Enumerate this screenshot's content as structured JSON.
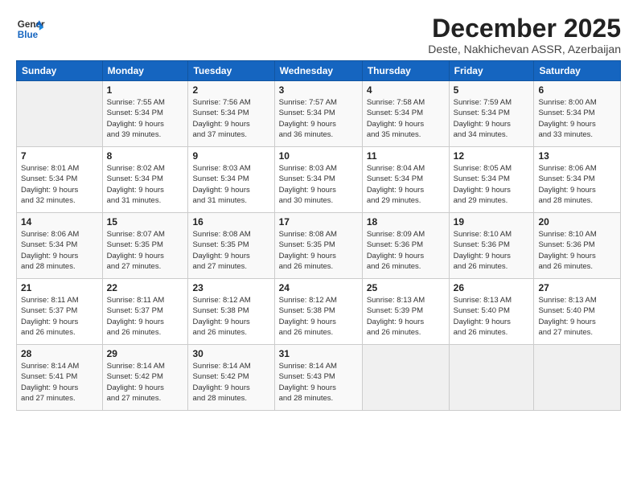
{
  "logo": {
    "line1": "General",
    "line2": "Blue"
  },
  "title": "December 2025",
  "location": "Deste, Nakhichevan ASSR, Azerbaijan",
  "days_of_week": [
    "Sunday",
    "Monday",
    "Tuesday",
    "Wednesday",
    "Thursday",
    "Friday",
    "Saturday"
  ],
  "weeks": [
    [
      {
        "day": "",
        "info": ""
      },
      {
        "day": "1",
        "info": "Sunrise: 7:55 AM\nSunset: 5:34 PM\nDaylight: 9 hours\nand 39 minutes."
      },
      {
        "day": "2",
        "info": "Sunrise: 7:56 AM\nSunset: 5:34 PM\nDaylight: 9 hours\nand 37 minutes."
      },
      {
        "day": "3",
        "info": "Sunrise: 7:57 AM\nSunset: 5:34 PM\nDaylight: 9 hours\nand 36 minutes."
      },
      {
        "day": "4",
        "info": "Sunrise: 7:58 AM\nSunset: 5:34 PM\nDaylight: 9 hours\nand 35 minutes."
      },
      {
        "day": "5",
        "info": "Sunrise: 7:59 AM\nSunset: 5:34 PM\nDaylight: 9 hours\nand 34 minutes."
      },
      {
        "day": "6",
        "info": "Sunrise: 8:00 AM\nSunset: 5:34 PM\nDaylight: 9 hours\nand 33 minutes."
      }
    ],
    [
      {
        "day": "7",
        "info": "Sunrise: 8:01 AM\nSunset: 5:34 PM\nDaylight: 9 hours\nand 32 minutes."
      },
      {
        "day": "8",
        "info": "Sunrise: 8:02 AM\nSunset: 5:34 PM\nDaylight: 9 hours\nand 31 minutes."
      },
      {
        "day": "9",
        "info": "Sunrise: 8:03 AM\nSunset: 5:34 PM\nDaylight: 9 hours\nand 31 minutes."
      },
      {
        "day": "10",
        "info": "Sunrise: 8:03 AM\nSunset: 5:34 PM\nDaylight: 9 hours\nand 30 minutes."
      },
      {
        "day": "11",
        "info": "Sunrise: 8:04 AM\nSunset: 5:34 PM\nDaylight: 9 hours\nand 29 minutes."
      },
      {
        "day": "12",
        "info": "Sunrise: 8:05 AM\nSunset: 5:34 PM\nDaylight: 9 hours\nand 29 minutes."
      },
      {
        "day": "13",
        "info": "Sunrise: 8:06 AM\nSunset: 5:34 PM\nDaylight: 9 hours\nand 28 minutes."
      }
    ],
    [
      {
        "day": "14",
        "info": "Sunrise: 8:06 AM\nSunset: 5:34 PM\nDaylight: 9 hours\nand 28 minutes."
      },
      {
        "day": "15",
        "info": "Sunrise: 8:07 AM\nSunset: 5:35 PM\nDaylight: 9 hours\nand 27 minutes."
      },
      {
        "day": "16",
        "info": "Sunrise: 8:08 AM\nSunset: 5:35 PM\nDaylight: 9 hours\nand 27 minutes."
      },
      {
        "day": "17",
        "info": "Sunrise: 8:08 AM\nSunset: 5:35 PM\nDaylight: 9 hours\nand 26 minutes."
      },
      {
        "day": "18",
        "info": "Sunrise: 8:09 AM\nSunset: 5:36 PM\nDaylight: 9 hours\nand 26 minutes."
      },
      {
        "day": "19",
        "info": "Sunrise: 8:10 AM\nSunset: 5:36 PM\nDaylight: 9 hours\nand 26 minutes."
      },
      {
        "day": "20",
        "info": "Sunrise: 8:10 AM\nSunset: 5:36 PM\nDaylight: 9 hours\nand 26 minutes."
      }
    ],
    [
      {
        "day": "21",
        "info": "Sunrise: 8:11 AM\nSunset: 5:37 PM\nDaylight: 9 hours\nand 26 minutes."
      },
      {
        "day": "22",
        "info": "Sunrise: 8:11 AM\nSunset: 5:37 PM\nDaylight: 9 hours\nand 26 minutes."
      },
      {
        "day": "23",
        "info": "Sunrise: 8:12 AM\nSunset: 5:38 PM\nDaylight: 9 hours\nand 26 minutes."
      },
      {
        "day": "24",
        "info": "Sunrise: 8:12 AM\nSunset: 5:38 PM\nDaylight: 9 hours\nand 26 minutes."
      },
      {
        "day": "25",
        "info": "Sunrise: 8:13 AM\nSunset: 5:39 PM\nDaylight: 9 hours\nand 26 minutes."
      },
      {
        "day": "26",
        "info": "Sunrise: 8:13 AM\nSunset: 5:40 PM\nDaylight: 9 hours\nand 26 minutes."
      },
      {
        "day": "27",
        "info": "Sunrise: 8:13 AM\nSunset: 5:40 PM\nDaylight: 9 hours\nand 27 minutes."
      }
    ],
    [
      {
        "day": "28",
        "info": "Sunrise: 8:14 AM\nSunset: 5:41 PM\nDaylight: 9 hours\nand 27 minutes."
      },
      {
        "day": "29",
        "info": "Sunrise: 8:14 AM\nSunset: 5:42 PM\nDaylight: 9 hours\nand 27 minutes."
      },
      {
        "day": "30",
        "info": "Sunrise: 8:14 AM\nSunset: 5:42 PM\nDaylight: 9 hours\nand 28 minutes."
      },
      {
        "day": "31",
        "info": "Sunrise: 8:14 AM\nSunset: 5:43 PM\nDaylight: 9 hours\nand 28 minutes."
      },
      {
        "day": "",
        "info": ""
      },
      {
        "day": "",
        "info": ""
      },
      {
        "day": "",
        "info": ""
      }
    ]
  ]
}
